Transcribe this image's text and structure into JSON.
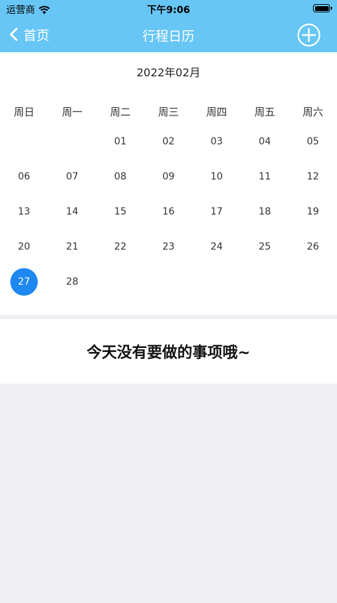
{
  "status_bar": {
    "carrier": "运营商",
    "time": "下午9:06"
  },
  "nav": {
    "back_label": "首页",
    "title": "行程日历",
    "add_icon": "plus-circle-icon"
  },
  "calendar": {
    "month_title": "2022年02月",
    "weekdays": [
      "周日",
      "周一",
      "周二",
      "周三",
      "周四",
      "周五",
      "周六"
    ],
    "days": [
      "",
      "",
      "01",
      "02",
      "03",
      "04",
      "05",
      "06",
      "07",
      "08",
      "09",
      "10",
      "11",
      "12",
      "13",
      "14",
      "15",
      "16",
      "17",
      "18",
      "19",
      "20",
      "21",
      "22",
      "23",
      "24",
      "25",
      "26",
      "27",
      "28",
      "",
      "",
      "",
      "",
      ""
    ],
    "selected_day": "27"
  },
  "empty_message": "今天没有要做的事项哦~",
  "colors": {
    "header": "#67c6f5",
    "selected": "#1e87f0",
    "background": "#efeff4"
  }
}
